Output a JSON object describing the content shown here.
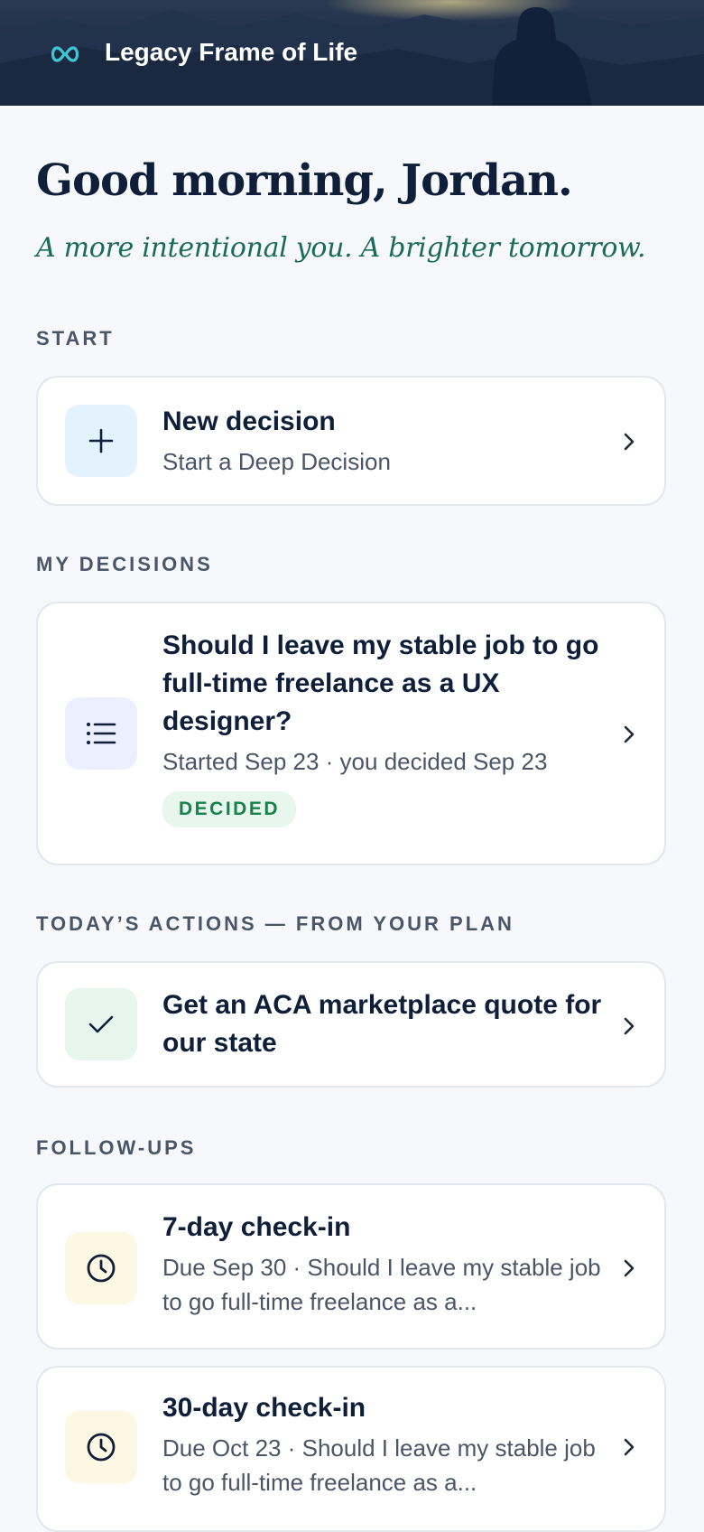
{
  "header": {
    "brand_icon": "infinity-icon",
    "title": "Legacy Frame of Life"
  },
  "greeting": {
    "title": "Good morning, Jordan.",
    "tagline": "A more intentional you. A brighter tomorrow."
  },
  "sections": {
    "start": {
      "label": "START",
      "card": {
        "icon": "plus-icon",
        "title": "New decision",
        "subtitle": "Start a Deep Decision"
      }
    },
    "my_decisions": {
      "label": "MY DECISIONS",
      "card": {
        "icon": "list-icon",
        "title": "Should I leave my stable job to go full-time freelance as a UX designer?",
        "meta": "Started Sep 23 · you decided Sep 23",
        "badge": "DECIDED"
      }
    },
    "todays_actions": {
      "label": "TODAY’S ACTIONS — FROM YOUR PLAN",
      "card": {
        "icon": "check-icon",
        "title": "Get an ACA marketplace quote for our state"
      }
    },
    "follow_ups": {
      "label": "FOLLOW-UPS",
      "items": [
        {
          "icon": "clock-icon",
          "title": "7-day check-in",
          "subtitle": "Due Sep 30 · Should I leave my stable job to go full-time freelance as a..."
        },
        {
          "icon": "clock-icon",
          "title": "30-day check-in",
          "subtitle": "Due Oct 23 · Should I leave my stable job to go full-time freelance as a..."
        }
      ]
    }
  },
  "colors": {
    "background": "#f6f8fb",
    "navy": "#0f1f3a",
    "accent_teal": "#3ec6d6",
    "tagline_green": "#1a6b5a",
    "decided_green": "#16834a",
    "tile_blue": "#e3f2fd",
    "tile_indigo": "#eceffe",
    "tile_mint": "#e8f7ee",
    "tile_cream": "#fdf7e3"
  }
}
